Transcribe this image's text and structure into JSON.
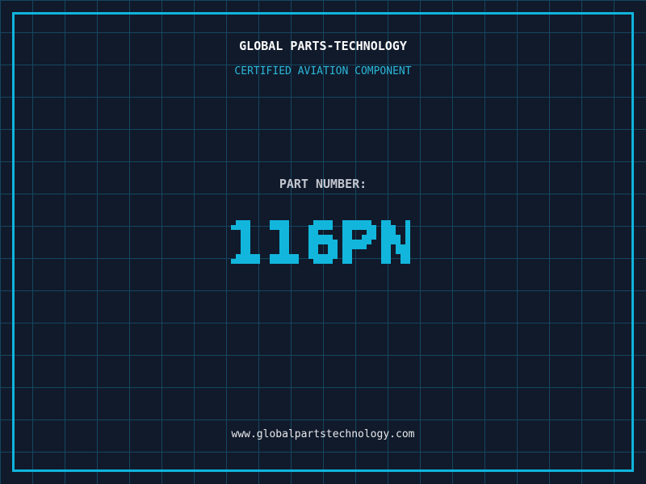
{
  "header": {
    "company": "GLOBAL PARTS-TECHNOLOGY",
    "subtitle": "CERTIFIED AVIATION COMPONENT"
  },
  "part": {
    "label": "PART NUMBER:",
    "value": "116PN"
  },
  "footer": {
    "website": "www.globalpartstechnology.com"
  },
  "colors": {
    "background": "#101a2b",
    "grid_line": "#15465f",
    "frame_cyan": "#10b4dc",
    "accent_cyan": "#12b6dc",
    "title_white": "#fafafa",
    "subtitle_cyan": "#2bb7d9",
    "label_gray": "#c3c6cf",
    "url_white": "#e9e9ec"
  }
}
